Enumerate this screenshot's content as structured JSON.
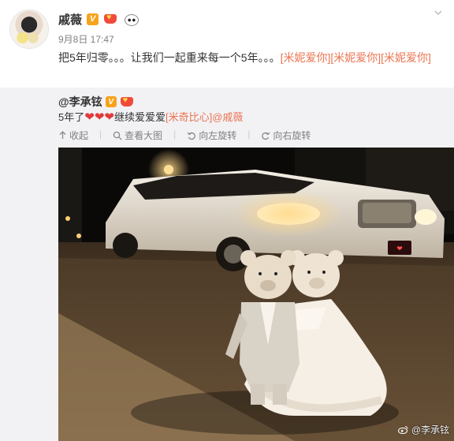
{
  "post": {
    "author": "戚薇",
    "timestamp": "9月8日 17:47",
    "text_plain": "把5年归零。。。让我们一起重来每一个5年。。。",
    "text_emoji": "[米妮爱你][米妮爱你][米妮爱你]"
  },
  "repost": {
    "author": "@李承铉",
    "text_prefix": "5年了",
    "text_middle": "继续爱爱爱",
    "text_emoji": "[米奇比心]",
    "mention": "@戚薇"
  },
  "toolbar": {
    "collapse_label": "收起",
    "view_large_label": "查看大图",
    "rotate_left_label": "向左旋转",
    "rotate_right_label": "向右旋转"
  },
  "photo": {
    "watermark": "@李承铉"
  },
  "icons": {
    "verified": "verified-badge-icon",
    "crown": "crown-badge-icon",
    "panda": "panda-badge-icon",
    "collapse": "collapse-arrow-icon",
    "search": "search-icon",
    "rotate_left": "rotate-left-icon",
    "rotate_right": "rotate-right-icon",
    "weibo": "weibo-logo-icon"
  },
  "colors": {
    "link": "#eb7350",
    "repost_bg": "#f2f2f5",
    "heart": "#e03a3a",
    "meta_text": "#808080"
  }
}
